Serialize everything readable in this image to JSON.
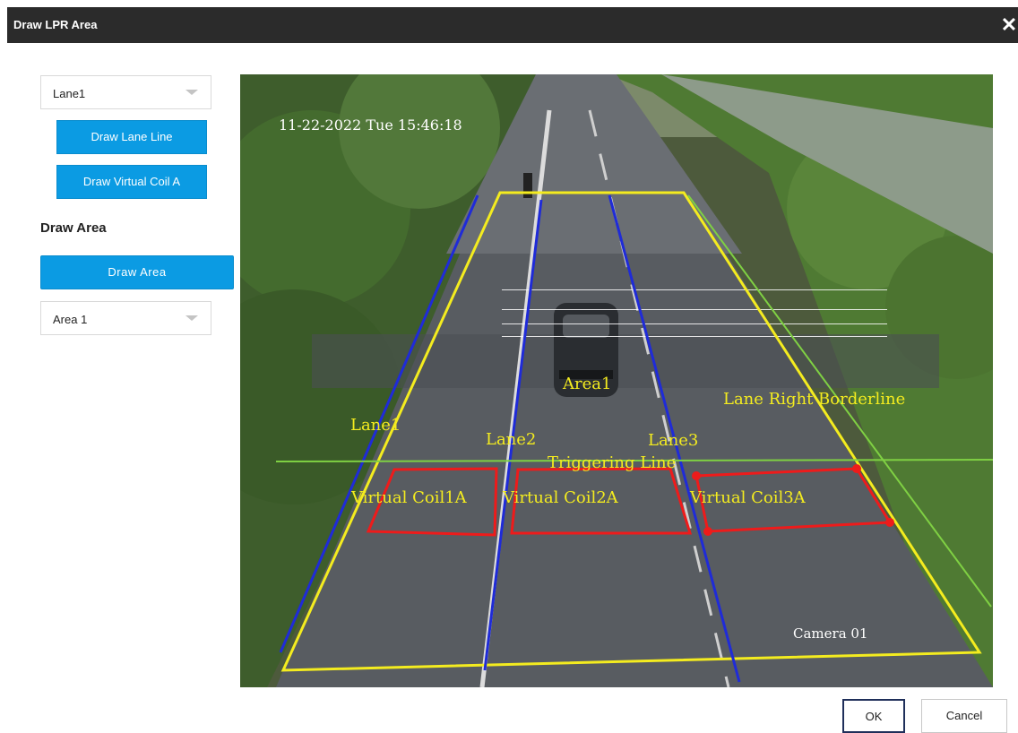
{
  "dialog": {
    "title": "Draw LPR Area",
    "close_icon": "close-icon"
  },
  "sidebar": {
    "lane_select": {
      "value": "Lane1"
    },
    "draw_lane_line_label": "Draw Lane Line",
    "draw_virtual_coil_label": "Draw Virtual Coil A",
    "draw_area_heading": "Draw Area",
    "draw_area_button_label": "Draw Area",
    "area_select": {
      "value": "Area 1"
    }
  },
  "video": {
    "timestamp": "11-22-2022 Tue 15:46:18",
    "camera_label": "Camera 01",
    "area_label": "Area1",
    "lane_labels": [
      "Lane1",
      "Lane2",
      "Lane3"
    ],
    "right_border_label": "Lane Right Borderline",
    "trigger_label": "Triggering Line",
    "coil_labels": [
      "Virtual Coil1A",
      "Virtual Coil2A",
      "Virtual Coil3A"
    ],
    "colors": {
      "area": "#f4ec1f",
      "lane_line": "#1f2bd8",
      "coil": "#ee1b1b",
      "trigger": "#7fd043",
      "border": "#7fd043"
    }
  },
  "footer": {
    "ok_label": "OK",
    "cancel_label": "Cancel"
  }
}
